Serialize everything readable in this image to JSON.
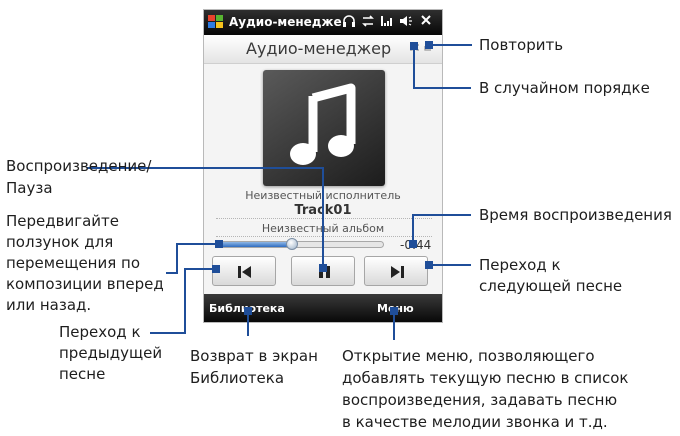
{
  "status_bar": {
    "title": "Аудио-менедже",
    "icons": [
      "windows-logo",
      "headphones-icon",
      "sync-icon",
      "signal-icon",
      "volume-icon",
      "close-icon"
    ]
  },
  "header": {
    "title": "Аудио-менеджер",
    "icons": [
      "shuffle-icon",
      "repeat-icon"
    ]
  },
  "now_playing": {
    "artist": "Неизвестный исполнитель",
    "track": "Track01",
    "album": "Неизвестный альбом",
    "time_remaining": "-0:44",
    "progress": 0.45
  },
  "controls": [
    "previous-track",
    "play-pause",
    "next-track"
  ],
  "softkeys": {
    "left": "Библиотека",
    "right": "Меню"
  },
  "colors": {
    "callout_line": "#1f4e99",
    "titlebar": "#111111",
    "slider_fill": "#3a78c9"
  },
  "callouts": {
    "repeat": "Повторить",
    "shuffle": "В случайном порядке",
    "play_pause_1": "Воспроизведение/",
    "play_pause_2": "Пауза",
    "seek_1": "Передвигайте",
    "seek_2": "ползунок для",
    "seek_3": "перемещения по",
    "seek_4": "композиции вперед",
    "seek_5": "или назад.",
    "prev_1": "Переход к",
    "prev_2": "предыдущей",
    "prev_3": "песне",
    "library_1": "Возврат в экран",
    "library_2": "Библиотека",
    "menu_1": "Открытие меню, позволяющего",
    "menu_2": "добавлять текущую песню в список",
    "menu_3": "воспроизведения, задавать песню",
    "menu_4": "в качестве мелодии звонка и т.д.",
    "time": "Время воспроизведения",
    "next_1": "Переход к",
    "next_2": "следующей песне"
  }
}
